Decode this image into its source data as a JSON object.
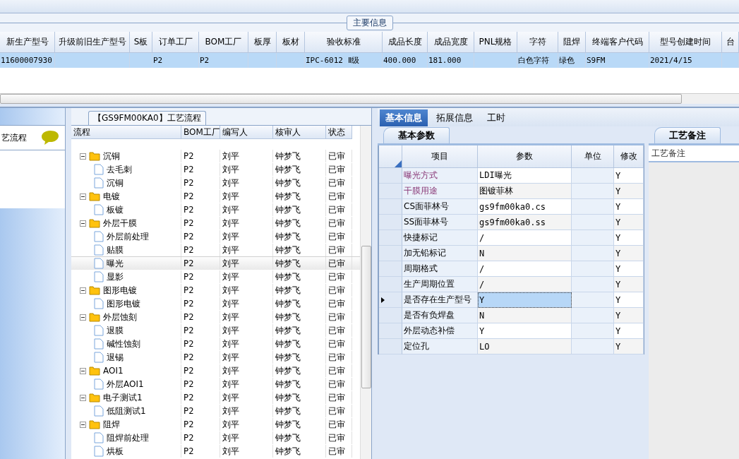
{
  "main_info": {
    "title": "主要信息",
    "columns": [
      "新生产型号",
      "升级前旧生产型号",
      "S板",
      "订单工厂",
      "BOM工厂",
      "板厚",
      "板材",
      "验收标准",
      "成品长度",
      "成品宽度",
      "PNL规格",
      "字符",
      "阻焊",
      "终端客户代码",
      "型号创建时间",
      "台"
    ],
    "rows": [
      {
        "selected": true,
        "cells": [
          "11600007930",
          "",
          "",
          "P2",
          "P2",
          "",
          "",
          "IPC-6012 Ⅱ级",
          "400.000",
          "181.000",
          "",
          "白色字符",
          "绿色",
          "S9FM",
          "2021/4/15",
          ""
        ]
      }
    ]
  },
  "sidebar": {
    "title": "艺流程"
  },
  "flow": {
    "title": "【GS9FM00KA0】工艺流程",
    "columns": [
      "流程",
      "BOM工厂",
      "编写人",
      "核审人",
      "状态"
    ],
    "nodes": [
      {
        "name": "沉铜",
        "bom": "P2",
        "writer": "刘平",
        "reviewer": "钟梦飞",
        "status": "已审",
        "expanded": true,
        "selected": false,
        "children": [
          {
            "name": "去毛刺",
            "bom": "P2",
            "writer": "刘平",
            "reviewer": "钟梦飞",
            "status": "已审",
            "selected": false
          },
          {
            "name": "沉铜",
            "bom": "P2",
            "writer": "刘平",
            "reviewer": "钟梦飞",
            "status": "已审",
            "selected": false
          }
        ]
      },
      {
        "name": "电镀",
        "bom": "P2",
        "writer": "刘平",
        "reviewer": "钟梦飞",
        "status": "已审",
        "expanded": true,
        "selected": false,
        "children": [
          {
            "name": "板镀",
            "bom": "P2",
            "writer": "刘平",
            "reviewer": "钟梦飞",
            "status": "已审",
            "selected": false
          }
        ]
      },
      {
        "name": "外层干膜",
        "bom": "P2",
        "writer": "刘平",
        "reviewer": "钟梦飞",
        "status": "已审",
        "expanded": true,
        "selected": false,
        "children": [
          {
            "name": "外层前处理",
            "bom": "P2",
            "writer": "刘平",
            "reviewer": "钟梦飞",
            "status": "已审",
            "selected": false
          },
          {
            "name": "贴膜",
            "bom": "P2",
            "writer": "刘平",
            "reviewer": "钟梦飞",
            "status": "已审",
            "selected": false
          },
          {
            "name": "曝光",
            "bom": "P2",
            "writer": "刘平",
            "reviewer": "钟梦飞",
            "status": "已审",
            "selected": true
          },
          {
            "name": "显影",
            "bom": "P2",
            "writer": "刘平",
            "reviewer": "钟梦飞",
            "status": "已审",
            "selected": false
          }
        ]
      },
      {
        "name": "图形电镀",
        "bom": "P2",
        "writer": "刘平",
        "reviewer": "钟梦飞",
        "status": "已审",
        "expanded": true,
        "selected": false,
        "children": [
          {
            "name": "图形电镀",
            "bom": "P2",
            "writer": "刘平",
            "reviewer": "钟梦飞",
            "status": "已审",
            "selected": false
          }
        ]
      },
      {
        "name": "外层蚀刻",
        "bom": "P2",
        "writer": "刘平",
        "reviewer": "钟梦飞",
        "status": "已审",
        "expanded": true,
        "selected": false,
        "children": [
          {
            "name": "退膜",
            "bom": "P2",
            "writer": "刘平",
            "reviewer": "钟梦飞",
            "status": "已审",
            "selected": false
          },
          {
            "name": "碱性蚀刻",
            "bom": "P2",
            "writer": "刘平",
            "reviewer": "钟梦飞",
            "status": "已审",
            "selected": false
          },
          {
            "name": "退锡",
            "bom": "P2",
            "writer": "刘平",
            "reviewer": "钟梦飞",
            "status": "已审",
            "selected": false
          }
        ]
      },
      {
        "name": "AOI1",
        "bom": "P2",
        "writer": "刘平",
        "reviewer": "钟梦飞",
        "status": "已审",
        "expanded": true,
        "selected": false,
        "children": [
          {
            "name": "外层AOI1",
            "bom": "P2",
            "writer": "刘平",
            "reviewer": "钟梦飞",
            "status": "已审",
            "selected": false
          }
        ]
      },
      {
        "name": "电子测试1",
        "bom": "P2",
        "writer": "刘平",
        "reviewer": "钟梦飞",
        "status": "已审",
        "expanded": true,
        "selected": false,
        "children": [
          {
            "name": "低阻测试1",
            "bom": "P2",
            "writer": "刘平",
            "reviewer": "钟梦飞",
            "status": "已审",
            "selected": false
          }
        ]
      },
      {
        "name": "阻焊",
        "bom": "P2",
        "writer": "刘平",
        "reviewer": "钟梦飞",
        "status": "已审",
        "expanded": true,
        "selected": false,
        "children": [
          {
            "name": "阻焊前处理",
            "bom": "P2",
            "writer": "刘平",
            "reviewer": "钟梦飞",
            "status": "已审",
            "selected": false
          },
          {
            "name": "烘板",
            "bom": "P2",
            "writer": "刘平",
            "reviewer": "钟梦飞",
            "status": "已审",
            "selected": false
          }
        ]
      }
    ]
  },
  "tabs": [
    {
      "label": "基本信息",
      "selected": true
    },
    {
      "label": "拓展信息",
      "selected": false
    },
    {
      "label": "工时",
      "selected": false
    }
  ],
  "params": {
    "tab": "基本参数",
    "columns": [
      "项目",
      "参数",
      "单位",
      "修改"
    ],
    "rows": [
      {
        "item": "曝光方式",
        "value": "LDI曝光",
        "unit": "",
        "modified": "Y",
        "required": true,
        "selected": false
      },
      {
        "item": "干膜用途",
        "value": "图镀菲林",
        "unit": "",
        "modified": "Y",
        "required": true,
        "selected": false
      },
      {
        "item": "CS面菲林号",
        "value": "gs9fm00ka0.cs",
        "unit": "",
        "modified": "Y",
        "required": false,
        "selected": false
      },
      {
        "item": "SS面菲林号",
        "value": "gs9fm00ka0.ss",
        "unit": "",
        "modified": "Y",
        "required": false,
        "selected": false
      },
      {
        "item": "快捷标记",
        "value": "/",
        "unit": "",
        "modified": "Y",
        "required": false,
        "selected": false
      },
      {
        "item": "加无铅标记",
        "value": "N",
        "unit": "",
        "modified": "Y",
        "required": false,
        "selected": false
      },
      {
        "item": "周期格式",
        "value": "/",
        "unit": "",
        "modified": "Y",
        "required": false,
        "selected": false
      },
      {
        "item": "生产周期位置",
        "value": "/",
        "unit": "",
        "modified": "Y",
        "required": false,
        "selected": false
      },
      {
        "item": "是否存在生产型号",
        "value": "Y",
        "unit": "",
        "modified": "Y",
        "required": false,
        "selected": true
      },
      {
        "item": "是否有负焊盘",
        "value": "N",
        "unit": "",
        "modified": "Y",
        "required": false,
        "selected": false
      },
      {
        "item": "外层动态补偿",
        "value": "Y",
        "unit": "",
        "modified": "Y",
        "required": false,
        "selected": false
      },
      {
        "item": "定位孔",
        "value": "LO",
        "unit": "",
        "modified": "Y",
        "required": false,
        "selected": false
      }
    ]
  },
  "remarks": {
    "tab": "工艺备注",
    "header": "工艺备注"
  }
}
